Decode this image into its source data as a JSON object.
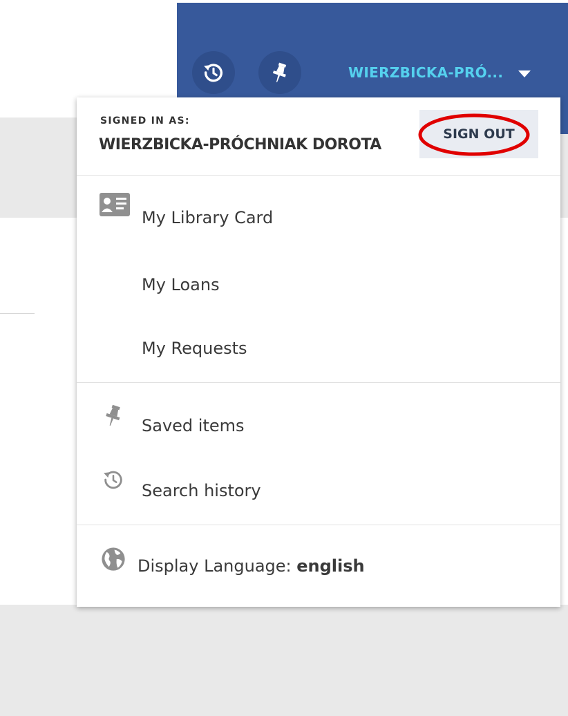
{
  "header": {
    "user_display": "WIERZBICKA-PRÓ...",
    "icons": {
      "history": "history-icon",
      "pin": "pin-icon",
      "dropdown": "caret-down-icon"
    }
  },
  "menu": {
    "signed_in_label": "SIGNED IN AS:",
    "user_full_name": "WIERZBICKA-PRÓCHNIAK DOROTA",
    "sign_out_label": "SIGN OUT",
    "account_items": [
      {
        "label": "My Library Card",
        "icon": "library-card-icon"
      },
      {
        "label": "My Loans"
      },
      {
        "label": "My Requests"
      }
    ],
    "personal_items": [
      {
        "label": "Saved items",
        "icon": "pin-icon"
      },
      {
        "label": "Search history",
        "icon": "history-icon"
      }
    ],
    "language": {
      "prefix": "Display Language: ",
      "value": "english",
      "icon": "globe-icon"
    }
  },
  "colors": {
    "header_bg": "#37599b",
    "user_text": "#55d1ee",
    "annotation": "#e00000"
  }
}
